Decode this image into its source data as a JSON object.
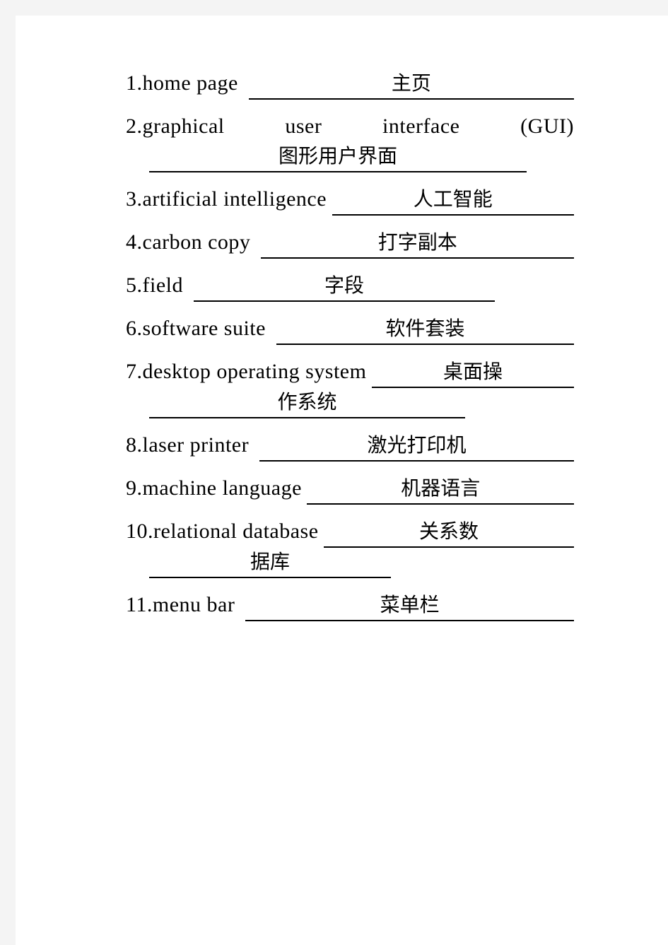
{
  "document": {
    "type": "vocabulary-worksheet",
    "items": [
      {
        "number": "1.",
        "term": "home page",
        "answer": "主页",
        "wrapped": false
      },
      {
        "number": "2.",
        "term_words": [
          "graphical",
          "user",
          "interface",
          "(GUI)"
        ],
        "term": "graphical user interface (GUI)",
        "answer": "图形用户界面",
        "wrapped": true
      },
      {
        "number": "3.",
        "term": "artificial intelligence",
        "answer": "人工智能",
        "wrapped": false
      },
      {
        "number": "4.",
        "term": "carbon copy",
        "answer": "打字副本",
        "wrapped": false
      },
      {
        "number": "5.",
        "term": "field",
        "answer": "字段",
        "wrapped": false
      },
      {
        "number": "6.",
        "term": "software suite",
        "answer": "软件套装",
        "wrapped": false
      },
      {
        "number": "7.",
        "term": "desktop operating system",
        "answer_line1": "桌面操",
        "answer_line2": "作系统",
        "answer": "桌面操作系统",
        "wrapped": true
      },
      {
        "number": "8.",
        "term": "laser printer",
        "answer": "激光打印机",
        "wrapped": false
      },
      {
        "number": "9.",
        "term": "machine language",
        "answer": "机器语言",
        "wrapped": false
      },
      {
        "number": "10. ",
        "term": "relational database",
        "answer_line1": "关系数",
        "answer_line2": "据库",
        "answer": "关系数据库",
        "wrapped": true
      },
      {
        "number": "11. ",
        "term": "menu bar",
        "answer": "菜单栏",
        "wrapped": false
      }
    ]
  }
}
